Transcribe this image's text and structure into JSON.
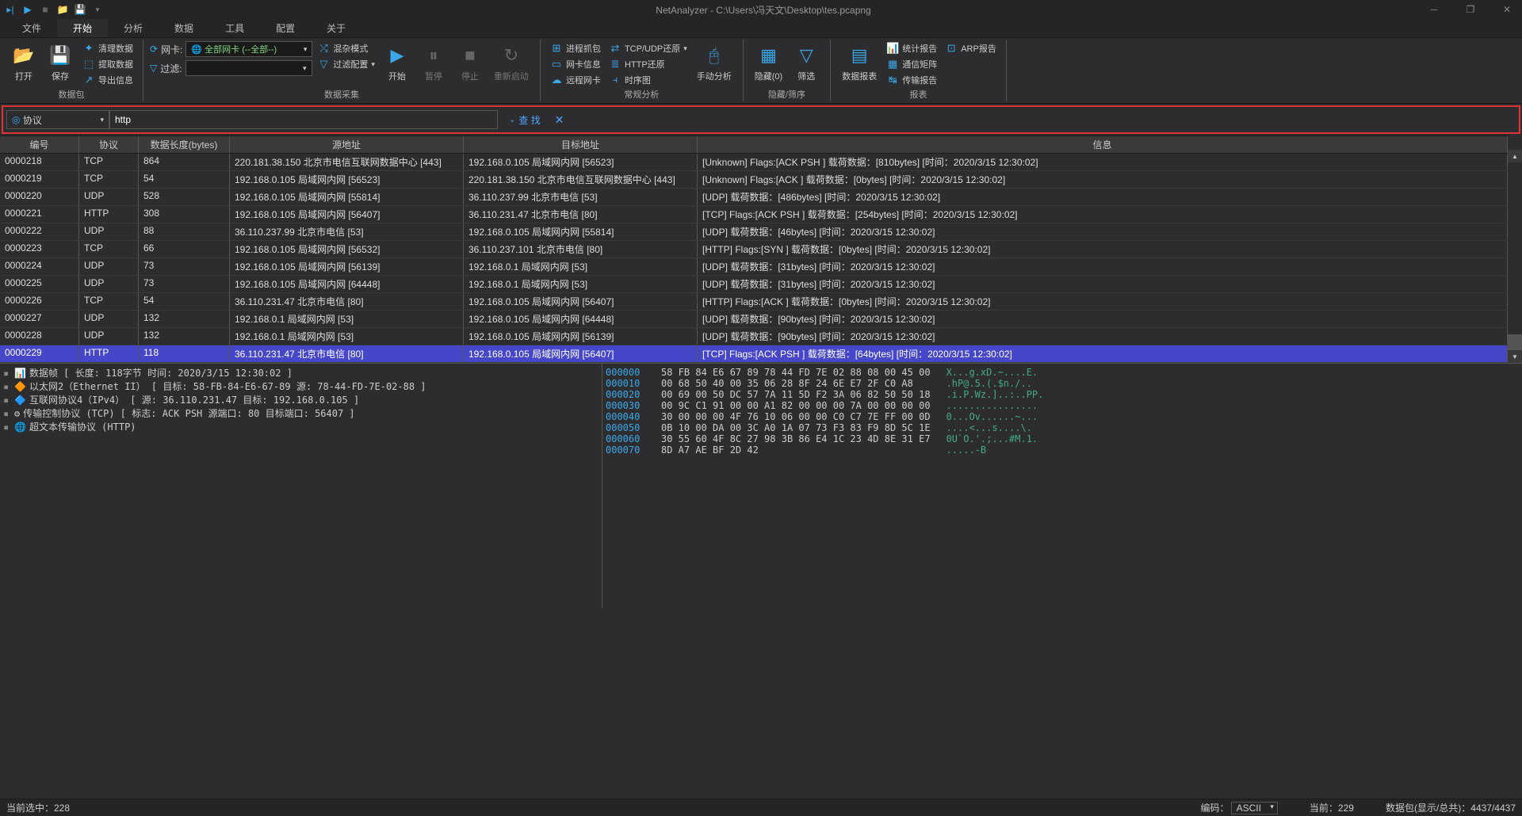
{
  "title": "NetAnalyzer - C:\\Users\\冯天文\\Desktop\\tes.pcapng",
  "menus": {
    "file": "文件",
    "start": "开始",
    "analyze": "分析",
    "data": "数据",
    "tools": "工具",
    "config": "配置",
    "about": "关于"
  },
  "ribbon": {
    "open": "打开",
    "save": "保存",
    "clear": "清理数据",
    "extract": "提取数据",
    "export": "导出信息",
    "group_packet": "数据包",
    "nic": "网卡:",
    "nic_sel": "全部网卡 (--全部--)",
    "filter": "过滤:",
    "mix": "混杂模式",
    "filter_cfg": "过滤配置",
    "start_cap": "开始",
    "pause": "暂停",
    "stop": "停止",
    "restart": "重新启动",
    "group_capture": "数据采集",
    "proc_cap": "进程抓包",
    "nic_info": "网卡信息",
    "remote_nic": "远程网卡",
    "tcp_restore": "TCP/UDP还原",
    "http_restore": "HTTP还原",
    "time_chart": "时序图",
    "manual": "手动分析",
    "group_regular": "常规分析",
    "hide": "隐藏(0)",
    "sieve": "筛选",
    "group_hide": "隐藏/筛序",
    "data_report": "数据报表",
    "stat_report": "统计报告",
    "comm_matrix": "通信矩阵",
    "trans_report": "传输报告",
    "arp_report": "ARP报告",
    "group_report": "报表"
  },
  "search": {
    "combo_label": "协议",
    "value": "http",
    "find": "查 找"
  },
  "columns": {
    "no": "编号",
    "proto": "协议",
    "len": "数据长度(bytes)",
    "src": "源地址",
    "dst": "目标地址",
    "info": "信息"
  },
  "rows": [
    {
      "no": "0000218",
      "proto": "TCP",
      "len": "864",
      "src": "220.181.38.150 北京市电信互联网数据中心 [443]",
      "dst": "192.168.0.105 局域网内网 [56523]",
      "info": "[Unknown] Flags:[ACK PSH ] 载荷数据：[810bytes] [时间：2020/3/15 12:30:02]"
    },
    {
      "no": "0000219",
      "proto": "TCP",
      "len": "54",
      "src": "192.168.0.105 局域网内网 [56523]",
      "dst": "220.181.38.150 北京市电信互联网数据中心 [443]",
      "info": "[Unknown] Flags:[ACK ] 载荷数据：[0bytes] [时间：2020/3/15 12:30:02]"
    },
    {
      "no": "0000220",
      "proto": "UDP",
      "len": "528",
      "src": "192.168.0.105 局域网内网 [55814]",
      "dst": "36.110.237.99 北京市电信 [53]",
      "info": "[UDP] 载荷数据：[486bytes] [时间：2020/3/15 12:30:02]"
    },
    {
      "no": "0000221",
      "proto": "HTTP",
      "len": "308",
      "src": "192.168.0.105 局域网内网 [56407]",
      "dst": "36.110.231.47 北京市电信 [80]",
      "info": "[TCP] Flags:[ACK PSH ] 载荷数据：[254bytes] [时间：2020/3/15 12:30:02]"
    },
    {
      "no": "0000222",
      "proto": "UDP",
      "len": "88",
      "src": "36.110.237.99 北京市电信 [53]",
      "dst": "192.168.0.105 局域网内网 [55814]",
      "info": "[UDP] 载荷数据：[46bytes] [时间：2020/3/15 12:30:02]"
    },
    {
      "no": "0000223",
      "proto": "TCP",
      "len": "66",
      "src": "192.168.0.105 局域网内网 [56532]",
      "dst": "36.110.237.101 北京市电信 [80]",
      "info": "[HTTP] Flags:[SYN ] 载荷数据：[0bytes] [时间：2020/3/15 12:30:02]"
    },
    {
      "no": "0000224",
      "proto": "UDP",
      "len": "73",
      "src": "192.168.0.105 局域网内网 [56139]",
      "dst": "192.168.0.1 局域网内网 [53]",
      "info": "[UDP] 载荷数据：[31bytes] [时间：2020/3/15 12:30:02]"
    },
    {
      "no": "0000225",
      "proto": "UDP",
      "len": "73",
      "src": "192.168.0.105 局域网内网 [64448]",
      "dst": "192.168.0.1 局域网内网 [53]",
      "info": "[UDP] 载荷数据：[31bytes] [时间：2020/3/15 12:30:02]"
    },
    {
      "no": "0000226",
      "proto": "TCP",
      "len": "54",
      "src": "36.110.231.47 北京市电信 [80]",
      "dst": "192.168.0.105 局域网内网 [56407]",
      "info": "[HTTP] Flags:[ACK ] 载荷数据：[0bytes] [时间：2020/3/15 12:30:02]"
    },
    {
      "no": "0000227",
      "proto": "UDP",
      "len": "132",
      "src": "192.168.0.1 局域网内网 [53]",
      "dst": "192.168.0.105 局域网内网 [64448]",
      "info": "[UDP] 载荷数据：[90bytes] [时间：2020/3/15 12:30:02]"
    },
    {
      "no": "0000228",
      "proto": "UDP",
      "len": "132",
      "src": "192.168.0.1 局域网内网 [53]",
      "dst": "192.168.0.105 局域网内网 [56139]",
      "info": "[UDP] 载荷数据：[90bytes] [时间：2020/3/15 12:30:02]"
    },
    {
      "no": "0000229",
      "proto": "HTTP",
      "len": "118",
      "src": "36.110.231.47 北京市电信 [80]",
      "dst": "192.168.0.105 局域网内网 [56407]",
      "info": "[TCP] Flags:[ACK PSH ] 载荷数据：[64bytes] [时间：2020/3/15 12:30:02]",
      "sel": true
    }
  ],
  "tree": [
    "数据帧 [ 长度: 118字节   时间: 2020/3/15 12:30:02 ]",
    "以太网2（Ethernet II） [ 目标: 58-FB-84-E6-67-89   源: 78-44-FD-7E-02-88 ]",
    "互联网协议4（IPv4） [ 源: 36.110.231.47 目标: 192.168.0.105 ]",
    "传输控制协议 (TCP) [ 标志: ACK PSH   源端口: 80 目标端口: 56407 ]",
    "超文本传输协议 (HTTP)"
  ],
  "hex": {
    "offsets": [
      "000000",
      "000010",
      "000020",
      "000030",
      "000040",
      "000050",
      "000060",
      "000070"
    ],
    "bytes": [
      "58 FB 84 E6 67 89 78 44 FD 7E 02 88 08 00 45 00",
      "00 68 50 40 00 35 06 28 8F 24 6E E7 2F C0 A8",
      "00 69 00 50 DC 57 7A 11 5D F2 3A 06 82 50 50 18",
      "00 9C C1 91 00 00 A1 82 00 00 00 7A 00 00 00 00",
      "30 00 00 00 4F 76 10 06 00 00 C0 C7 7E FF 00 0D",
      "0B 10 00 DA 00 3C A0 1A 07 73 F3 83 F9 8D 5C 1E",
      "30 55 60 4F 8C 27 98 3B 86 E4 1C 23 4D 8E 31 E7",
      "8D A7 AE BF 2D 42"
    ],
    "ascii": [
      "X...g.xD.~....E.",
      ".hP@.5.(.$n./..",
      ".i.P.Wz.]..:..PP.",
      "................",
      "0...Ov......~...",
      "....<...s....\\.",
      "0U`O.'.;...#M.1.",
      ".....-B"
    ]
  },
  "status": {
    "sel": "当前选中：228",
    "encoding_label": "编码：",
    "encoding": "ASCII",
    "current": "当前：229",
    "total": "数据包(显示/总共)：4437/4437"
  }
}
